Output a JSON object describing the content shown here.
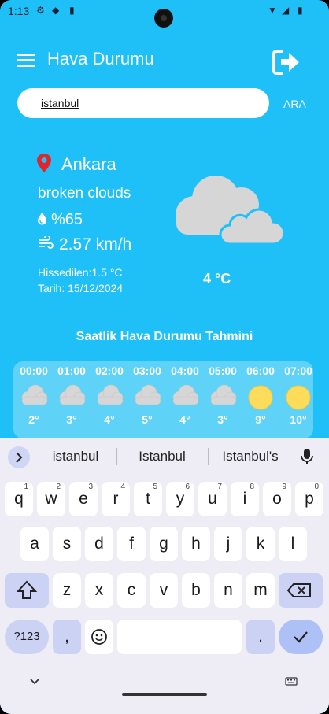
{
  "status_bar": {
    "time": "1:13"
  },
  "app_bar": {
    "title": "Hava Durumu"
  },
  "search": {
    "value": "istanbul",
    "button_label": "ARA"
  },
  "current_weather": {
    "city": "Ankara",
    "description": "broken clouds",
    "humidity": "%65",
    "wind": "2.57 km/h",
    "feels_like": "Hissedilen:1.5 °C",
    "date": "Tarih: 15/12/2024",
    "temperature": "4 °C",
    "icon": "broken-clouds-icon"
  },
  "hourly": {
    "title": "Saatlik Hava Durumu Tahmini",
    "items": [
      {
        "hour": "00:00",
        "temp": "2°",
        "icon": "cloud-icon"
      },
      {
        "hour": "01:00",
        "temp": "3°",
        "icon": "cloud-icon"
      },
      {
        "hour": "02:00",
        "temp": "4°",
        "icon": "cloud-icon"
      },
      {
        "hour": "03:00",
        "temp": "5°",
        "icon": "cloud-icon"
      },
      {
        "hour": "04:00",
        "temp": "4°",
        "icon": "cloud-icon"
      },
      {
        "hour": "05:00",
        "temp": "3°",
        "icon": "cloud-icon"
      },
      {
        "hour": "06:00",
        "temp": "9°",
        "icon": "sun-icon"
      },
      {
        "hour": "07:00",
        "temp": "10°",
        "icon": "sun-icon"
      }
    ]
  },
  "keyboard": {
    "suggestions": [
      "istanbul",
      "Istanbul",
      "Istanbul's"
    ],
    "row1": [
      {
        "key": "q",
        "hint": "1"
      },
      {
        "key": "w",
        "hint": "2"
      },
      {
        "key": "e",
        "hint": "3"
      },
      {
        "key": "r",
        "hint": "4"
      },
      {
        "key": "t",
        "hint": "5"
      },
      {
        "key": "y",
        "hint": "6"
      },
      {
        "key": "u",
        "hint": "7"
      },
      {
        "key": "i",
        "hint": "8"
      },
      {
        "key": "o",
        "hint": "9"
      },
      {
        "key": "p",
        "hint": "0"
      }
    ],
    "row2": [
      "a",
      "s",
      "d",
      "f",
      "g",
      "h",
      "j",
      "k",
      "l"
    ],
    "row3": [
      "z",
      "x",
      "c",
      "v",
      "b",
      "n",
      "m"
    ],
    "symbols_label": "?123",
    "comma": ",",
    "period": "."
  },
  "colors": {
    "background": "#1ec0f7",
    "hourly_strip": "#5fd2f8",
    "pin": "#e0262b",
    "sun": "#fddc5c",
    "cloud": "#d6d6d6"
  }
}
